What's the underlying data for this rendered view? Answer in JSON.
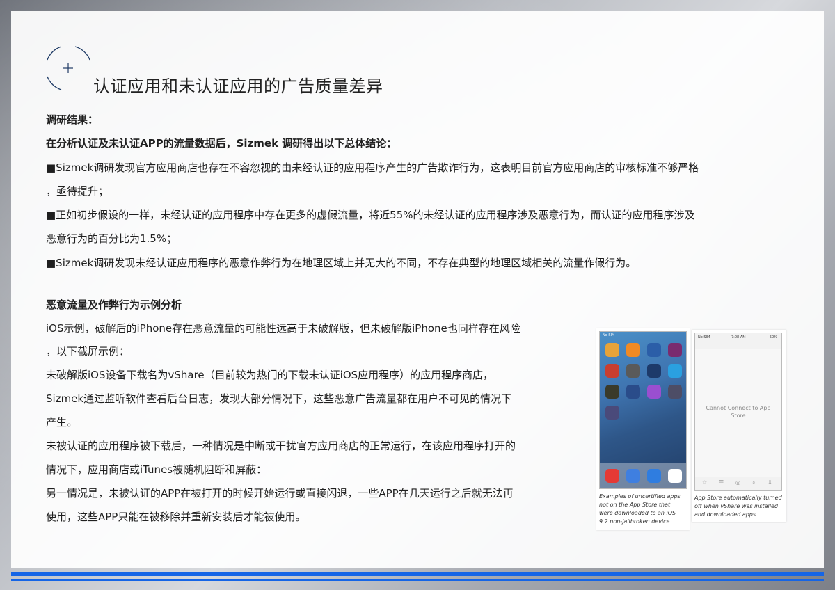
{
  "title": "认证应用和未认证应用的广告质量差异",
  "section1": {
    "heading": "调研结果：",
    "intro": "在分析认证及未认证APP的流量数据后，Sizmek 调研得出以下总体结论：",
    "lines": [
      "■Sizmek调研发现官方应用商店也存在不容忽视的由未经认证的应用程序产生的广告欺诈行为，这表明目前官方应用商店的审核标准不够严格",
      "，亟待提升；",
      "■正如初步假设的一样，未经认证的应用程序中存在更多的虚假流量，将近55%的未经认证的应用程序涉及恶意行为，而认证的应用程序涉及",
      "恶意行为的百分比为1.5%；",
      "■Sizmek调研发现未经认证应用程序的恶意作弊行为在地理区域上并无大的不同，不存在典型的地理区域相关的流量作假行为。"
    ]
  },
  "section2": {
    "heading": "恶意流量及作弊行为示例分析",
    "lines": [
      "iOS示例，破解后的iPhone存在恶意流量的可能性远高于未破解版，但未破解版iPhone也同样存在风险",
      "，以下截屏示例：",
      "未破解版iOS设备下载名为vShare（目前较为热门的下载未认证iOS应用程序）的应用程序商店，",
      "Sizmek通过监听软件查看后台日志，发现大部分情况下，这些恶意广告流量都在用户不可见的情况下",
      "产生。",
      "未被认证的应用程序被下载后，一种情况是中断或干扰官方应用商店的正常运行，在该应用程序打开的",
      "情况下，应用商店或iTunes被随机阻断和屏蔽：",
      "另一情况是，未被认证的APP在被打开的时候开始运行或直接闪退，一些APP在几天运行之后就无法再",
      "使用，这些APP只能在被移除并重新安装后才能被使用。"
    ]
  },
  "screenshots": {
    "left": {
      "status_carrier": "No SIM",
      "caption": "Examples of uncertified apps not on the App Store that were downloaded to an iOS 9.2 non-jailbroken device"
    },
    "right": {
      "status_carrier": "No SIM",
      "status_time": "7:08 AM",
      "status_battery": "50%",
      "message": "Cannot Connect to App Store",
      "caption": "App Store automatically turned off when vShare was installed and downloaded apps"
    }
  },
  "colors": {
    "accent": "#1565e6",
    "logo_navy": "#1f3b66"
  }
}
